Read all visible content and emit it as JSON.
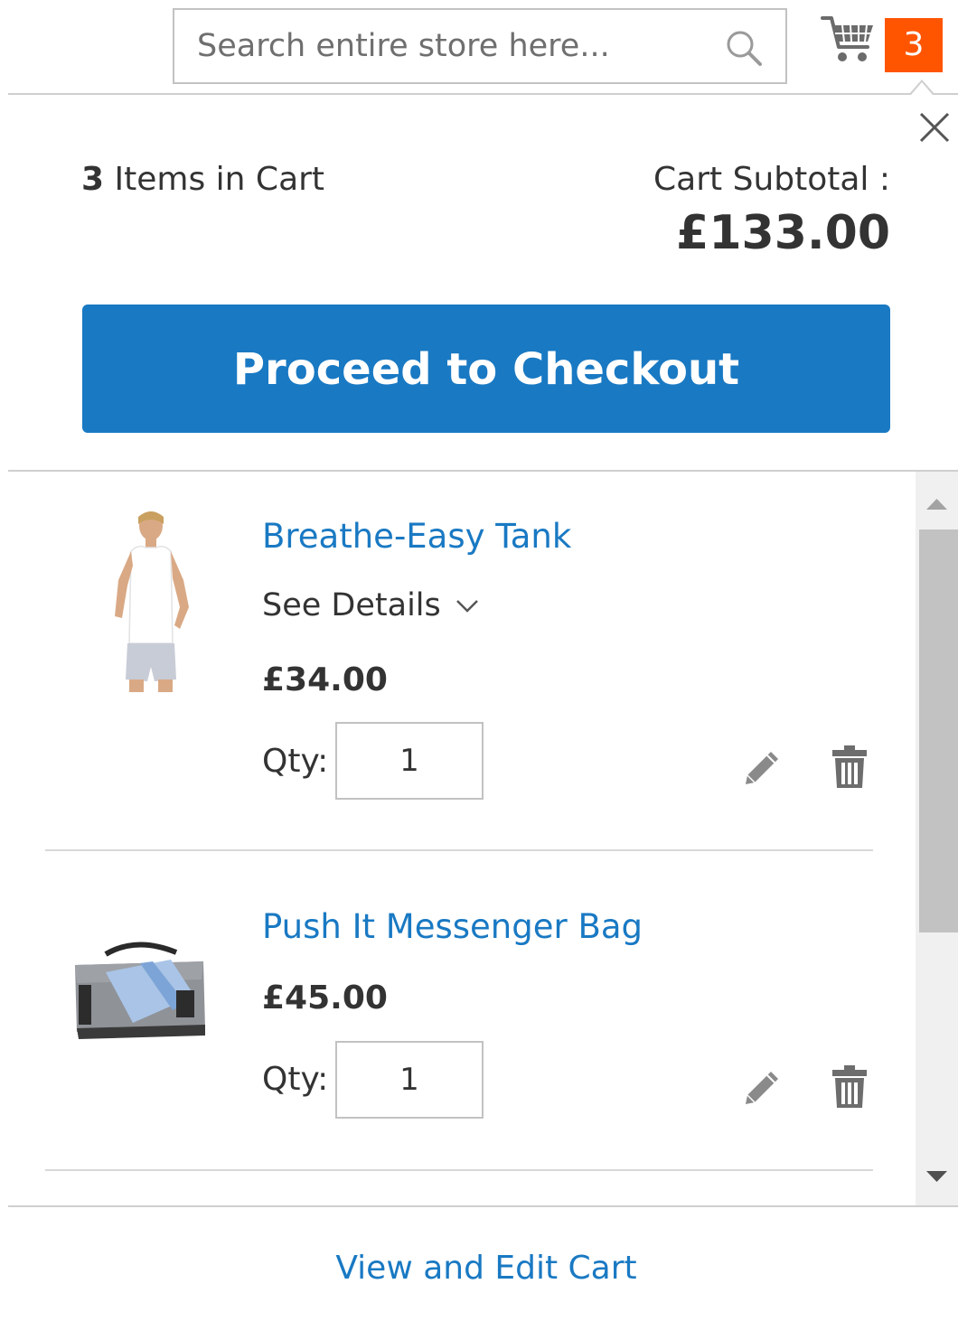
{
  "header": {
    "search_placeholder": "Search entire store here...",
    "cart_count": "3"
  },
  "summary": {
    "items_count": "3",
    "items_label": "Items in Cart",
    "subtotal_label": "Cart Subtotal :",
    "subtotal_value": "£133.00"
  },
  "checkout": {
    "label": "Proceed to Checkout"
  },
  "items": [
    {
      "name": "Breathe-Easy Tank",
      "details_label": "See Details",
      "price": "£34.00",
      "qty_label": "Qty:",
      "qty": "1",
      "thumb_icon": "tank-top-photo"
    },
    {
      "name": "Push It Messenger Bag",
      "price": "£45.00",
      "qty_label": "Qty:",
      "qty": "1",
      "thumb_icon": "messenger-bag-photo"
    }
  ],
  "footer": {
    "view_cart_label": "View and Edit Cart"
  },
  "colors": {
    "accent": "#1979c3",
    "badge": "#ff5501",
    "text": "#333333"
  }
}
